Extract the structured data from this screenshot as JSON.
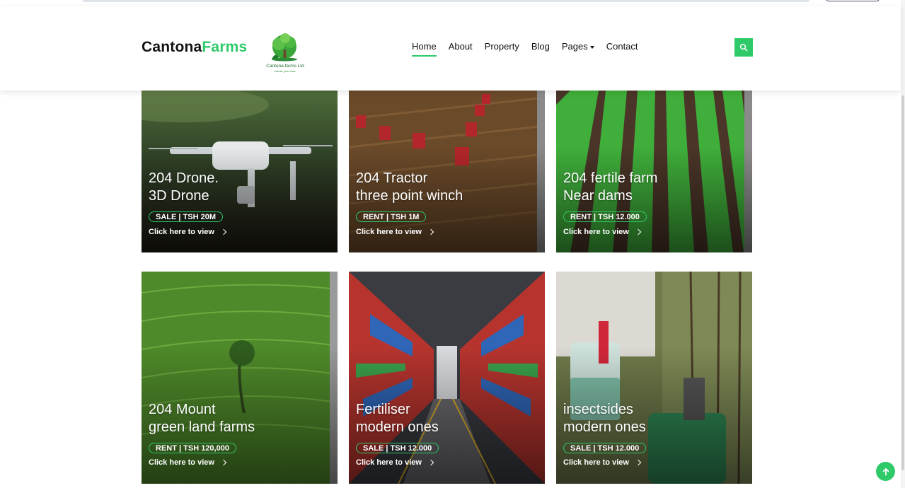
{
  "brand": {
    "part1": "Cantona",
    "part2": "Farms",
    "logo_caption": "Cantona farms Ltd",
    "logo_tagline": "cultivate. grow. share."
  },
  "nav": {
    "items": [
      {
        "label": "Home",
        "active": true
      },
      {
        "label": "About",
        "active": false
      },
      {
        "label": "Property",
        "active": false
      },
      {
        "label": "Blog",
        "active": false
      },
      {
        "label": "Pages",
        "active": false,
        "has_dropdown": true
      },
      {
        "label": "Contact",
        "active": false
      }
    ]
  },
  "search": {
    "icon": "search-icon"
  },
  "colors": {
    "accent": "#2eca6a",
    "text": "#111111"
  },
  "cards": [
    {
      "line1": "204 Drone.",
      "line2": "3D Drone",
      "badge": "SALE | TSH 20M",
      "link": "Click here to view",
      "scene": "drone"
    },
    {
      "line1": "204 Tractor",
      "line2": "three point winch",
      "badge": "RENT | TSH 1M",
      "link": "Click here to view",
      "scene": "tractors"
    },
    {
      "line1": "204 fertile farm",
      "line2": "Near dams",
      "badge": "RENT | TSH 12.000",
      "link": "Click here to view",
      "scene": "rows"
    },
    {
      "line1": "204 Mount",
      "line2": "green land farms",
      "badge": "RENT | TSH 120,000",
      "link": "Click here to view",
      "scene": "terraces"
    },
    {
      "line1": "Fertiliser",
      "line2": "modern ones",
      "badge": "SALE | TSH 12.000",
      "link": "Click here to view",
      "scene": "warehouse"
    },
    {
      "line1": "insectsides",
      "line2": "modern ones",
      "badge": "SALE | TSH 12.000",
      "link": "Click here to view",
      "scene": "sprayer"
    }
  ],
  "back_to_top": {
    "icon": "arrow-up-icon"
  }
}
